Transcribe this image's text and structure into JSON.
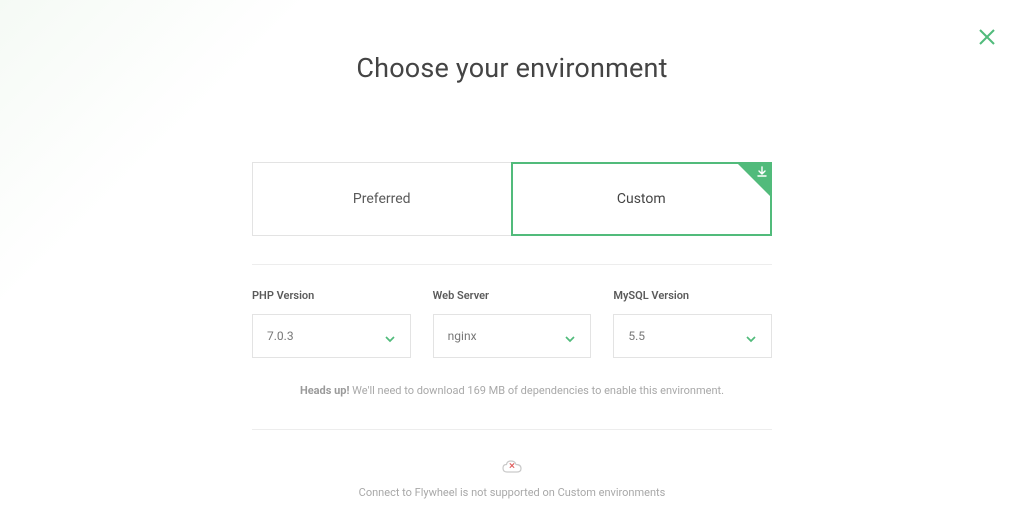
{
  "title": "Choose your environment",
  "tabs": {
    "preferred": "Preferred",
    "custom": "Custom"
  },
  "controls": {
    "php": {
      "label": "PHP Version",
      "value": "7.0.3"
    },
    "webserver": {
      "label": "Web Server",
      "value": "nginx"
    },
    "mysql": {
      "label": "MySQL Version",
      "value": "5.5"
    }
  },
  "heads_up": {
    "bold": "Heads up!",
    "text": " We'll need to download 169 MB of dependencies to enable this environment."
  },
  "cloud_notice": "Connect to Flywheel is not supported on Custom environments"
}
